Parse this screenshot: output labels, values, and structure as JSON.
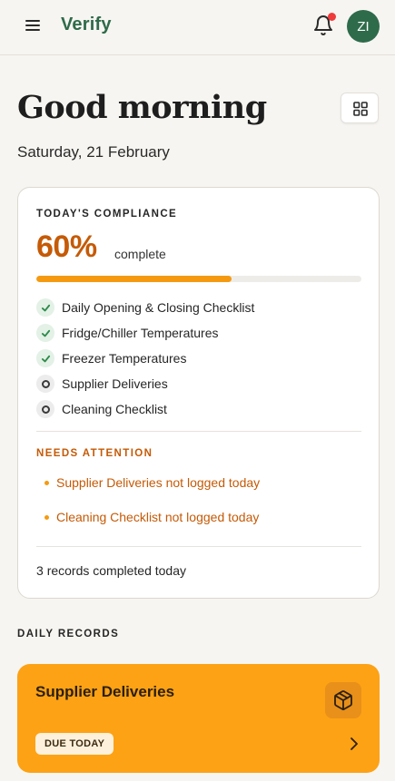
{
  "header": {
    "brand": "Verify",
    "avatar_initials": "ZI",
    "brand_color": "#2e6b4a",
    "notification_dot_color": "#ef3b3b"
  },
  "greeting": {
    "title": "Good morning",
    "date": "Saturday, 21 February"
  },
  "compliance": {
    "label": "TODAY'S COMPLIANCE",
    "percent_text": "60%",
    "percent_value": 60,
    "percent_suffix": "complete",
    "accent_color": "#c55a06",
    "checklist": [
      {
        "label": "Daily Opening & Closing Checklist",
        "done": true
      },
      {
        "label": "Fridge/Chiller Temperatures",
        "done": true
      },
      {
        "label": "Freezer Temperatures",
        "done": true
      },
      {
        "label": "Supplier Deliveries",
        "done": false
      },
      {
        "label": "Cleaning Checklist",
        "done": false
      }
    ],
    "attention_label": "NEEDS ATTENTION",
    "attention_items": [
      "Supplier Deliveries not logged today",
      "Cleaning Checklist not logged today"
    ],
    "records_count": "3",
    "records_text": "records completed today"
  },
  "daily_records": {
    "label": "DAILY RECORDS",
    "cards": [
      {
        "title": "Supplier Deliveries",
        "badge": "DUE TODAY",
        "icon": "box-icon",
        "color": "#fda214"
      }
    ]
  }
}
